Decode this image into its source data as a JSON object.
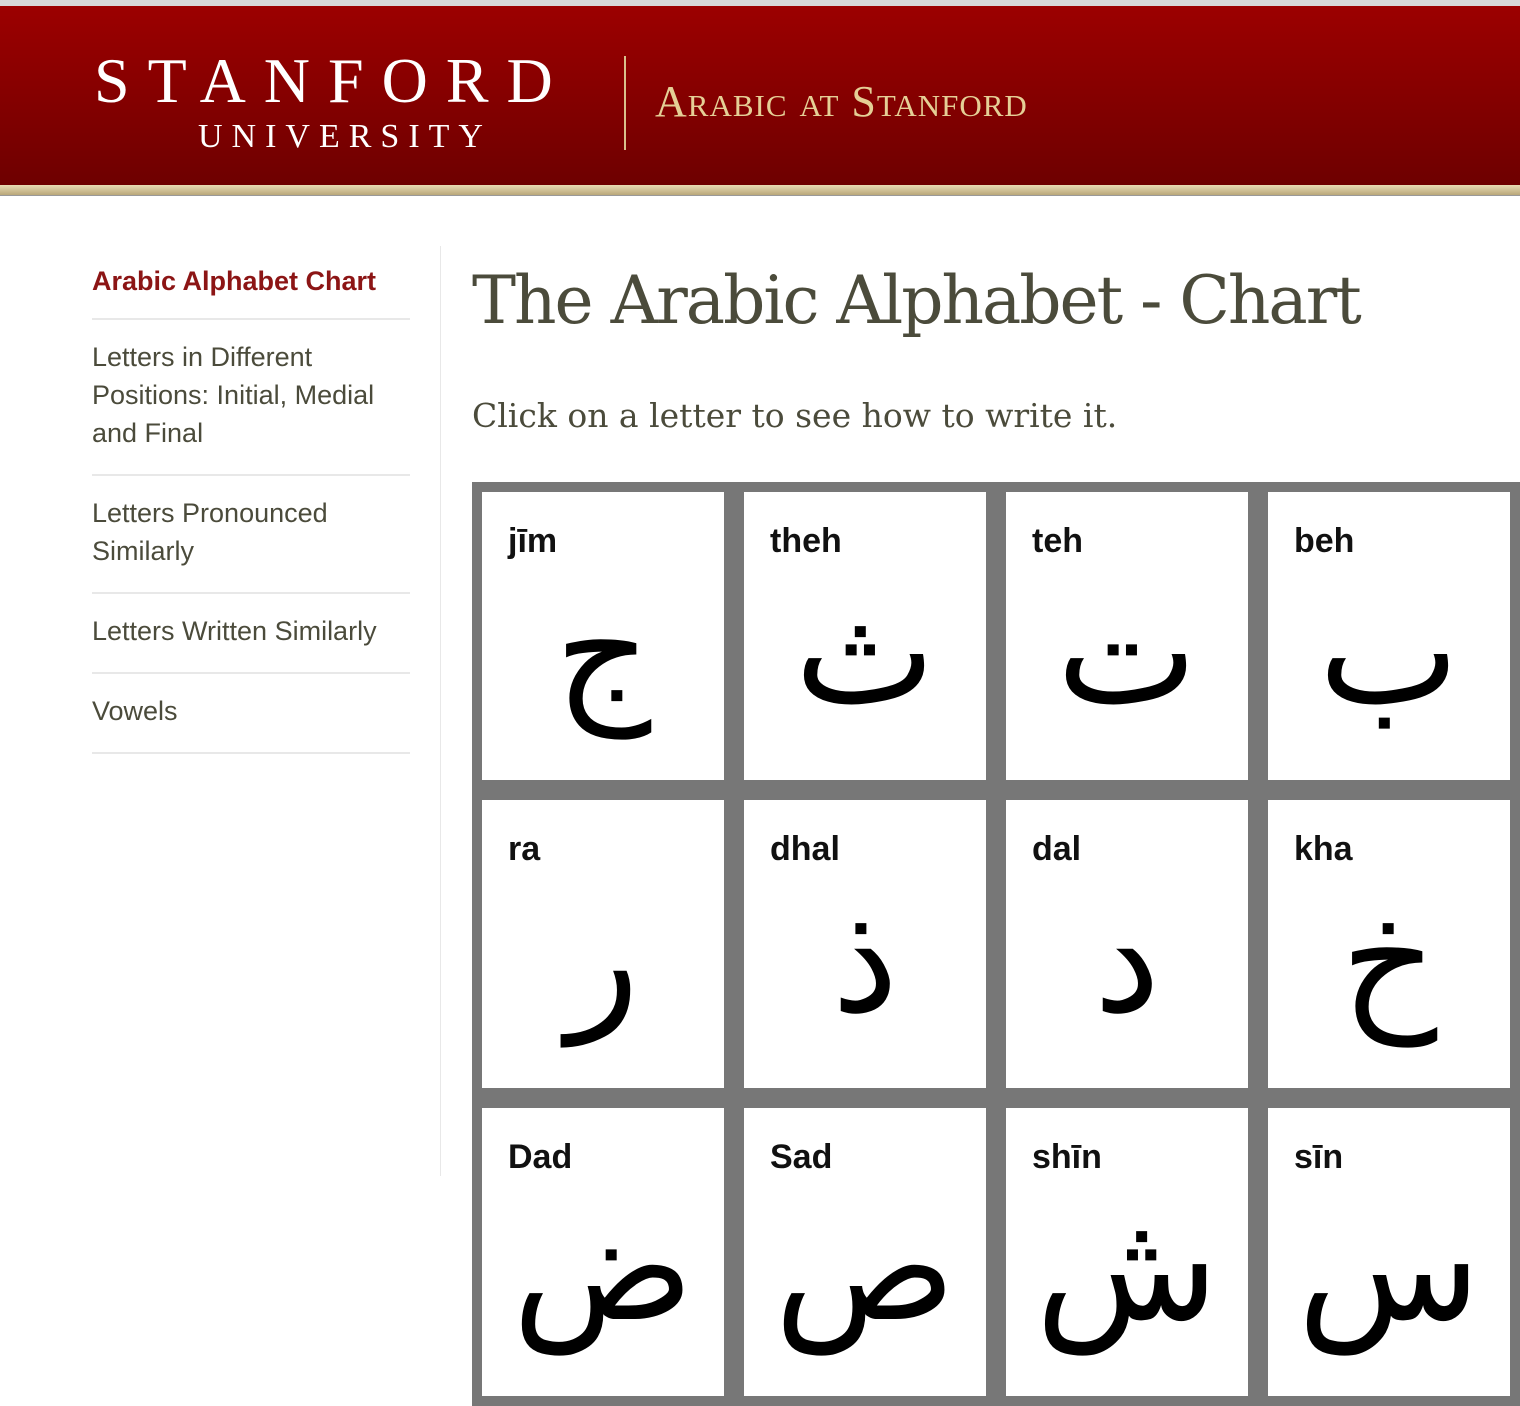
{
  "header": {
    "logo_line1": "STANFORD",
    "logo_line2": "UNIVERSITY",
    "site_title": "Arabic at Stanford"
  },
  "sidebar": {
    "items": [
      {
        "label": "Arabic Alphabet Chart",
        "active": true
      },
      {
        "label": "Letters in Different Positions: Initial, Medial and Final"
      },
      {
        "label": "Letters Pronounced Similarly"
      },
      {
        "label": "Letters Written Similarly"
      },
      {
        "label": "Vowels"
      }
    ]
  },
  "main": {
    "title": "The Arabic Alphabet - Chart",
    "intro": "Click on a letter to see how to write it.",
    "letters": [
      {
        "name": "jīm",
        "glyph": "ج"
      },
      {
        "name": "theh",
        "glyph": "ث"
      },
      {
        "name": "teh",
        "glyph": "ت"
      },
      {
        "name": "beh",
        "glyph": "ب"
      },
      {
        "name": "ra",
        "glyph": "ر"
      },
      {
        "name": "dhal",
        "glyph": "ذ"
      },
      {
        "name": "dal",
        "glyph": "د"
      },
      {
        "name": "kha",
        "glyph": "خ"
      },
      {
        "name": "Dad",
        "glyph": "ض"
      },
      {
        "name": "Sad",
        "glyph": "ص"
      },
      {
        "name": "shīn",
        "glyph": "ش"
      },
      {
        "name": "sīn",
        "glyph": "س"
      }
    ]
  }
}
